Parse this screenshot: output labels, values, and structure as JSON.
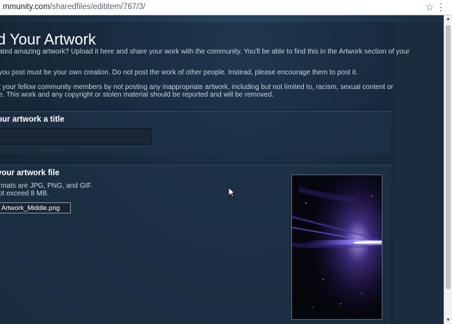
{
  "browser": {
    "url_host": "mmunity.com",
    "url_path": "/sharedfiles/edititem/767/3/",
    "icons": [
      "star-icon",
      "more-vert-icon"
    ]
  },
  "page": {
    "title": "d Your Artwork",
    "desc1": "ated amazing artwork? Upload it here and share your work with the community. You'll be able to find this in the Artwork section of your",
    "desc2": "you post must be your own creation. Do not post the work of other people. Instead, please encourage them to post it.",
    "desc3a": "t your fellow community members by not posting any inappropriate artwork, including but not limited to, racism, sexual content or",
    "desc3b": "e. This work and any copyright or stolen material should be reported and will be removed."
  },
  "title_section": {
    "label": "our artwork a title",
    "input_value": ""
  },
  "file_section": {
    "label": "your artwork file",
    "formats": "rmats are JPG, PNG, and GIF.",
    "size_limit": "ot exceed 8 MB.",
    "file_name": "Artwork_Middle.png"
  },
  "colors": {
    "page_bg": "#1b2838",
    "text": "#c6d4df",
    "heading": "#ffffff"
  }
}
